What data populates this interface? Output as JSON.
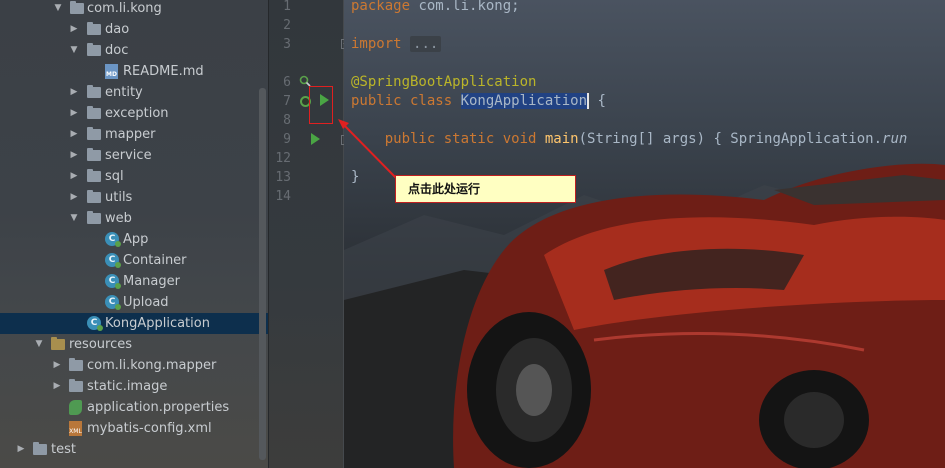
{
  "project_tree": {
    "items": [
      {
        "label": "com.li.kong",
        "expanded": true
      },
      {
        "label": "dao",
        "expanded": false
      },
      {
        "label": "doc",
        "expanded": true
      },
      {
        "label": "README.md",
        "icon": "markdown-file-icon"
      },
      {
        "label": "entity",
        "expanded": false
      },
      {
        "label": "exception",
        "expanded": false
      },
      {
        "label": "mapper",
        "expanded": false
      },
      {
        "label": "service",
        "expanded": false
      },
      {
        "label": "sql",
        "expanded": false
      },
      {
        "label": "utils",
        "expanded": false
      },
      {
        "label": "web",
        "expanded": true
      },
      {
        "label": "App",
        "icon": "spring-class-icon"
      },
      {
        "label": "Container",
        "icon": "spring-class-icon"
      },
      {
        "label": "Manager",
        "icon": "spring-class-icon"
      },
      {
        "label": "Upload",
        "icon": "spring-class-icon"
      },
      {
        "label": "KongApplication",
        "icon": "spring-boot-class-icon",
        "selected": true
      },
      {
        "label": "resources",
        "expanded": true
      },
      {
        "label": "com.li.kong.mapper",
        "expanded": false
      },
      {
        "label": "static.image",
        "expanded": false
      },
      {
        "label": "application.properties",
        "icon": "spring-properties-icon"
      },
      {
        "label": "mybatis-config.xml",
        "icon": "xml-file-icon"
      },
      {
        "label": "test",
        "expanded": false
      }
    ]
  },
  "editor": {
    "line_numbers": [
      "1",
      "2",
      "3",
      "6",
      "7",
      "8",
      "9",
      "12",
      "13",
      "14"
    ],
    "code": {
      "l1_kw": "package",
      "l1_rest": " com.li.kong;",
      "l3_kw": "import",
      "l3_folded": "...",
      "l6_annotation": "@SpringBootApplication",
      "l7_kw": "public class ",
      "l7_class": "KongApplication",
      "l7_rest": " {",
      "l9_kw": "public static void ",
      "l9_method": "main",
      "l9_params": "(String[] args) { SpringApplication.",
      "l9_call": "run",
      "l13_brace": "}"
    }
  },
  "annotation": {
    "callout_text": "点击此处运行",
    "color": "#e02020"
  },
  "colors": {
    "keyword": "#cc7832",
    "annotation": "#bbb529",
    "method": "#ffc66d",
    "run_icon": "#4aa544",
    "selection": "#0d2f4d"
  }
}
